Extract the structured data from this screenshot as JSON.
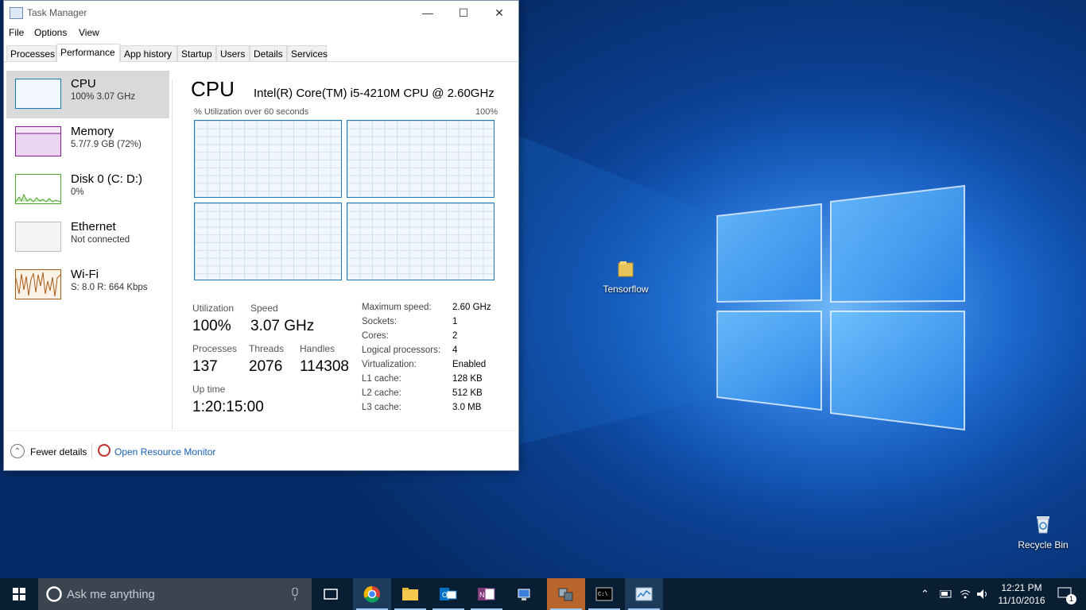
{
  "window": {
    "title": "Task Manager",
    "menu": [
      "File",
      "Options",
      "View"
    ],
    "tabs": [
      "Processes",
      "Performance",
      "App history",
      "Startup",
      "Users",
      "Details",
      "Services"
    ],
    "active_tab": "Performance"
  },
  "sidebar": [
    {
      "name": "CPU",
      "sub": "100%  3.07 GHz",
      "color": "#1a7ab8",
      "selected": true
    },
    {
      "name": "Memory",
      "sub": "5.7/7.9 GB (72%)",
      "color": "#8b1a9b"
    },
    {
      "name": "Disk 0 (C: D:)",
      "sub": "0%",
      "color": "#4aa52b"
    },
    {
      "name": "Ethernet",
      "sub": "Not connected",
      "color": "#999999"
    },
    {
      "name": "Wi-Fi",
      "sub": "S: 8.0  R: 664 Kbps",
      "color": "#a75a14"
    }
  ],
  "cpu": {
    "title": "CPU",
    "model": "Intel(R) Core(TM) i5-4210M CPU @ 2.60GHz",
    "graph_label": "% Utilization over 60 seconds",
    "graph_max": "100%",
    "stats": {
      "utilization_label": "Utilization",
      "utilization": "100%",
      "speed_label": "Speed",
      "speed": "3.07 GHz",
      "processes_label": "Processes",
      "processes": "137",
      "threads_label": "Threads",
      "threads": "2076",
      "handles_label": "Handles",
      "handles": "114308",
      "uptime_label": "Up time",
      "uptime": "1:20:15:00"
    },
    "specs": [
      {
        "k": "Maximum speed:",
        "v": "2.60 GHz"
      },
      {
        "k": "Sockets:",
        "v": "1"
      },
      {
        "k": "Cores:",
        "v": "2"
      },
      {
        "k": "Logical processors:",
        "v": "4"
      },
      {
        "k": "Virtualization:",
        "v": "Enabled"
      },
      {
        "k": "L1 cache:",
        "v": "128 KB"
      },
      {
        "k": "L2 cache:",
        "v": "512 KB"
      },
      {
        "k": "L3 cache:",
        "v": "3.0 MB"
      }
    ]
  },
  "footer": {
    "fewer": "Fewer details",
    "resource_monitor": "Open Resource Monitor"
  },
  "desktop": {
    "icons": [
      "Tensorflow",
      "Recycle Bin"
    ]
  },
  "taskbar": {
    "search_placeholder": "Ask me anything",
    "apps": [
      "task-view",
      "chrome",
      "file-explorer",
      "outlook",
      "onenote",
      "remote",
      "virtualbox",
      "cmd",
      "task-manager"
    ],
    "time": "12:21 PM",
    "date": "11/10/2016",
    "notification_count": "1"
  }
}
